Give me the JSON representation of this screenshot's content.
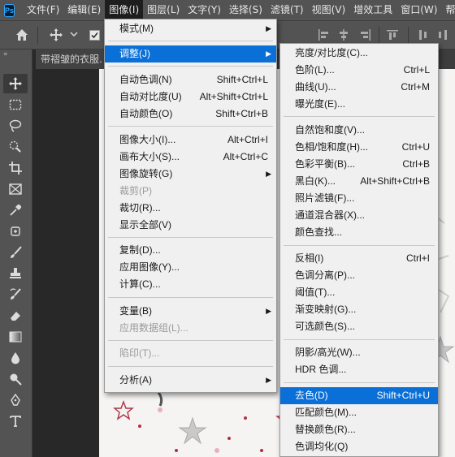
{
  "app": {
    "logo": "Ps"
  },
  "menubar": [
    {
      "label": "文件(F)"
    },
    {
      "label": "编辑(E)"
    },
    {
      "label": "图像(I)"
    },
    {
      "label": "图层(L)"
    },
    {
      "label": "文字(Y)"
    },
    {
      "label": "选择(S)"
    },
    {
      "label": "滤镜(T)"
    },
    {
      "label": "视图(V)"
    },
    {
      "label": "增效工具"
    },
    {
      "label": "窗口(W)"
    },
    {
      "label": "帮"
    }
  ],
  "document_tab": {
    "title": "带褶皱的衣服."
  },
  "image_menu": {
    "items": [
      {
        "label": "模式(M)",
        "shortcut": ""
      },
      {
        "label": "调整(J)",
        "shortcut": ""
      },
      {
        "label": "自动色调(N)",
        "shortcut": "Shift+Ctrl+L"
      },
      {
        "label": "自动对比度(U)",
        "shortcut": "Alt+Shift+Ctrl+L"
      },
      {
        "label": "自动颜色(O)",
        "shortcut": "Shift+Ctrl+B"
      },
      {
        "label": "图像大小(I)...",
        "shortcut": "Alt+Ctrl+I"
      },
      {
        "label": "画布大小(S)...",
        "shortcut": "Alt+Ctrl+C"
      },
      {
        "label": "图像旋转(G)",
        "shortcut": ""
      },
      {
        "label": "裁剪(P)",
        "shortcut": ""
      },
      {
        "label": "裁切(R)...",
        "shortcut": ""
      },
      {
        "label": "显示全部(V)",
        "shortcut": ""
      },
      {
        "label": "复制(D)...",
        "shortcut": ""
      },
      {
        "label": "应用图像(Y)...",
        "shortcut": ""
      },
      {
        "label": "计算(C)...",
        "shortcut": ""
      },
      {
        "label": "变量(B)",
        "shortcut": ""
      },
      {
        "label": "应用数据组(L)...",
        "shortcut": ""
      },
      {
        "label": "陷印(T)...",
        "shortcut": ""
      },
      {
        "label": "分析(A)",
        "shortcut": ""
      }
    ]
  },
  "adjust_menu": {
    "items": [
      {
        "label": "亮度/对比度(C)...",
        "shortcut": ""
      },
      {
        "label": "色阶(L)...",
        "shortcut": "Ctrl+L"
      },
      {
        "label": "曲线(U)...",
        "shortcut": "Ctrl+M"
      },
      {
        "label": "曝光度(E)...",
        "shortcut": ""
      },
      {
        "label": "自然饱和度(V)...",
        "shortcut": ""
      },
      {
        "label": "色相/饱和度(H)...",
        "shortcut": "Ctrl+U"
      },
      {
        "label": "色彩平衡(B)...",
        "shortcut": "Ctrl+B"
      },
      {
        "label": "黑白(K)...",
        "shortcut": "Alt+Shift+Ctrl+B"
      },
      {
        "label": "照片滤镜(F)...",
        "shortcut": ""
      },
      {
        "label": "通道混合器(X)...",
        "shortcut": ""
      },
      {
        "label": "颜色查找...",
        "shortcut": ""
      },
      {
        "label": "反相(I)",
        "shortcut": "Ctrl+I"
      },
      {
        "label": "色调分离(P)...",
        "shortcut": ""
      },
      {
        "label": "阈值(T)...",
        "shortcut": ""
      },
      {
        "label": "渐变映射(G)...",
        "shortcut": ""
      },
      {
        "label": "可选颜色(S)...",
        "shortcut": ""
      },
      {
        "label": "阴影/高光(W)...",
        "shortcut": ""
      },
      {
        "label": "HDR 色调...",
        "shortcut": ""
      },
      {
        "label": "去色(D)",
        "shortcut": "Shift+Ctrl+U"
      },
      {
        "label": "匹配颜色(M)...",
        "shortcut": ""
      },
      {
        "label": "替换颜色(R)...",
        "shortcut": ""
      },
      {
        "label": "色调均化(Q)",
        "shortcut": ""
      }
    ]
  },
  "colors": {
    "highlight": "#0a6fd6",
    "menu_bg": "#f0f0f0",
    "chrome": "#535353"
  }
}
